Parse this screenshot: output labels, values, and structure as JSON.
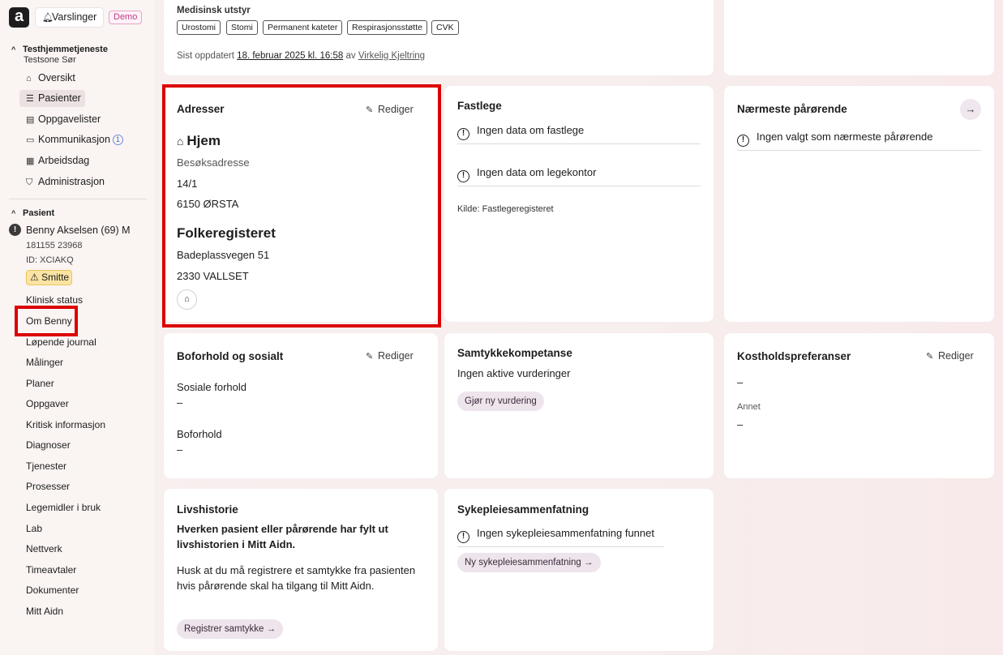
{
  "app": {
    "logo": "a",
    "notifications_label": "Varslinger",
    "demo_badge": "Demo"
  },
  "sidebar": {
    "org_title": "Testhjemmetjeneste",
    "org_sub": "Testsone Sør",
    "nav": [
      {
        "label": "Oversikt",
        "icon": "home-icon"
      },
      {
        "label": "Pasienter",
        "icon": "patients-icon"
      },
      {
        "label": "Oppgavelister",
        "icon": "clipboard-icon"
      },
      {
        "label": "Kommunikasjon",
        "icon": "chat-icon",
        "badge": "1"
      },
      {
        "label": "Arbeidsdag",
        "icon": "calendar-icon"
      },
      {
        "label": "Administrasjon",
        "icon": "shield-icon"
      }
    ],
    "patient_section": "Pasient",
    "patient_name": "Benny Akselsen (69) M",
    "patient_ssn": "181155 23968",
    "patient_id": "ID: XCIAKQ",
    "smitte": "Smitte",
    "patient_nav": [
      "Klinisk status",
      "Om Benny",
      "Løpende journal",
      "Målinger",
      "Planer",
      "Oppgaver",
      "Kritisk informasjon",
      "Diagnoser",
      "Tjenester",
      "Prosesser",
      "Legemidler i bruk",
      "Lab",
      "Nettverk",
      "Timeavtaler",
      "Dokumenter",
      "Mitt Aidn"
    ]
  },
  "top_card": {
    "title": "Medisinsk utstyr",
    "tags": [
      "Urostomi",
      "Stomi",
      "Permanent kateter",
      "Respirasjonsstøtte",
      "CVK"
    ],
    "updated_prefix": "Sist oppdatert",
    "updated_date": "18. februar 2025 kl. 16:58",
    "updated_by_prefix": "av",
    "updated_by": "Virkelig Kjeltring"
  },
  "addresses": {
    "title": "Adresser",
    "edit": "Rediger",
    "home_title": "Hjem",
    "home_type": "Besøksadresse",
    "home_line1": "14/1",
    "home_line2": "6150 ØRSTA",
    "reg_title": "Folkeregisteret",
    "reg_line1": "Badeplassvegen 51",
    "reg_line2": "2330 VALLSET"
  },
  "fastlege": {
    "title": "Fastlege",
    "no_gp": "Ingen data om fastlege",
    "no_office": "Ingen data om legekontor",
    "source": "Kilde: Fastlegeregisteret"
  },
  "next_of_kin": {
    "title": "Nærmeste pårørende",
    "empty": "Ingen valgt som nærmeste pårørende"
  },
  "housing": {
    "title": "Boforhold og sosialt",
    "edit": "Rediger",
    "social_label": "Sosiale forhold",
    "social_value": "–",
    "housing_label": "Boforhold",
    "housing_value": "–"
  },
  "consent": {
    "title": "Samtykkekompetanse",
    "status": "Ingen aktive vurderinger",
    "button": "Gjør ny vurdering"
  },
  "diet": {
    "title": "Kostholdspreferanser",
    "edit": "Rediger",
    "value": "–",
    "other_label": "Annet",
    "other_value": "–"
  },
  "life_story": {
    "title": "Livshistorie",
    "bold_text": "Hverken pasient eller pårørende har fylt ut livshistorien i Mitt Aidn.",
    "text": "Husk at du må registrere et samtykke fra pasienten hvis pårørende skal ha tilgang til Mitt Aidn.",
    "button": "Registrer samtykke"
  },
  "nursing_summary": {
    "title": "Sykepleiesammenfatning",
    "empty": "Ingen sykepleiesammenfatning funnet",
    "button": "Ny sykepleiesammenfatning"
  }
}
